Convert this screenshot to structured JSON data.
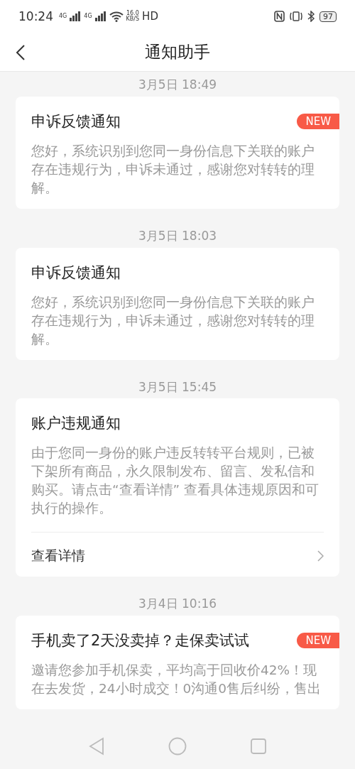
{
  "status_bar": {
    "time": "10:24",
    "sim_labels": [
      "4G",
      "4G"
    ],
    "speed_value": "16.0",
    "speed_unit": "KB/S",
    "hd": "HD",
    "battery": "97"
  },
  "header": {
    "title": "通知助手"
  },
  "notifications": [
    {
      "date": "3月5日 18:49",
      "title": "申诉反馈通知",
      "badge": "NEW",
      "body": "您好，系统识别到您同一身份信息下关联的账户存在违规行为，申诉未通过，感谢您对转转的理解。"
    },
    {
      "date": "3月5日 18:03",
      "title": "申诉反馈通知",
      "body": "您好，系统识别到您同一身份信息下关联的账户存在违规行为，申诉未通过，感谢您对转转的理解。"
    },
    {
      "date": "3月5日 15:45",
      "title": "账户违规通知",
      "body": "由于您同一身份的账户违反转转平台规则，已被下架所有商品，永久限制发布、留言、发私信和购买。请点击“查看详情” 查看具体违规原因和可执行的操作。",
      "action": "查看详情"
    },
    {
      "date": "3月4日 10:16",
      "title": "手机卖了2天没卖掉？走保卖试试",
      "badge": "NEW",
      "body": "邀请您参加手机保卖，平均高于回收价42%！现在去发货，24小时成交！0沟通0售后纠纷，售出"
    }
  ]
}
